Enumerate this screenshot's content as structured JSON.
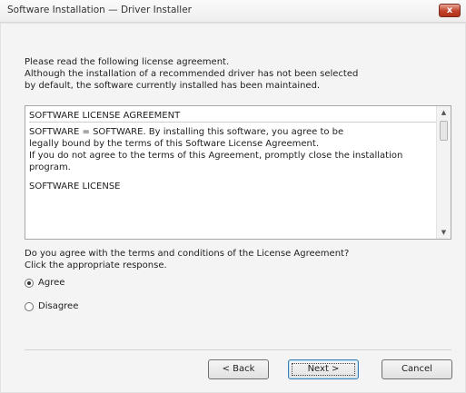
{
  "window": {
    "title": "Software Installation — Driver Installer",
    "close_glyph": "x"
  },
  "instructions": [
    "Please read the following license agreement.",
    "Although the installation of a recommended driver has not been selected",
    "by default, the software currently installed has been maintained."
  ],
  "license": {
    "lines": [
      "SOFTWARE LICENSE AGREEMENT",
      "",
      "SOFTWARE = SOFTWARE. By installing this software, you agree to be",
      "legally bound by the terms of this Software License Agreement.",
      "If you do not agree to the terms of this Agreement, promptly close the installation",
      "program.",
      "",
      "SOFTWARE LICENSE"
    ],
    "scroll_up_glyph": "▲",
    "scroll_down_glyph": "▼"
  },
  "question": {
    "line1": "Do you agree with the terms and conditions of the License Agreement?",
    "line2": "Click the appropriate response."
  },
  "options": [
    {
      "label": "Agree",
      "selected": true
    },
    {
      "label": "Disagree",
      "selected": false
    }
  ],
  "buttons": {
    "back": "< Back",
    "next": "Next >",
    "cancel": "Cancel"
  }
}
